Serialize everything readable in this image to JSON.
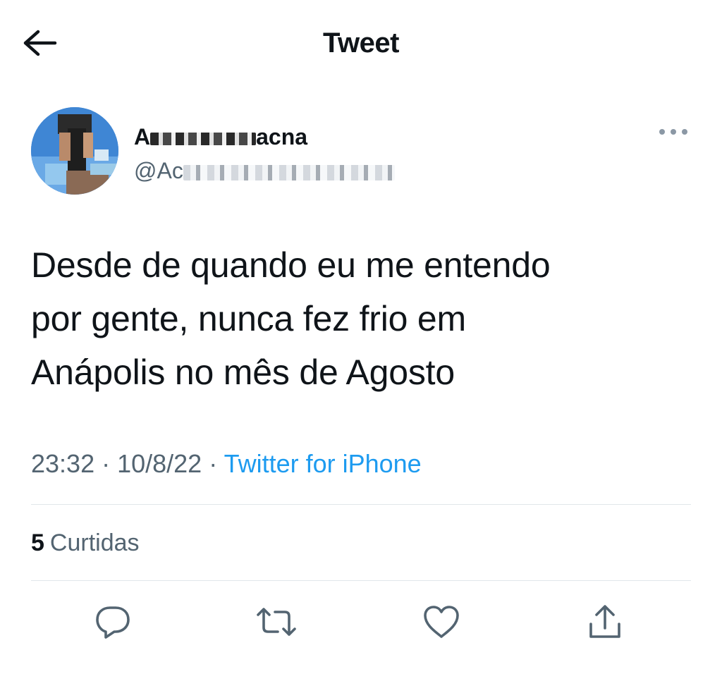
{
  "header": {
    "title": "Tweet",
    "back_icon": "arrow-left-icon"
  },
  "author": {
    "display_name_visible": "A",
    "display_name_tail": "acna",
    "handle_visible": "@Ac",
    "avatar": "user-avatar"
  },
  "tweet": {
    "lines": [
      "Desde de quando eu me entendo",
      "por gente, nunca fez frio em",
      "Anápolis no mês de Agosto"
    ],
    "time": "23:32",
    "date": "10/8/22",
    "separator": " · ",
    "source": "Twitter for iPhone"
  },
  "stats": {
    "likes_count": "5",
    "likes_label": "Curtidas"
  },
  "actions": {
    "reply_icon": "reply-icon",
    "retweet_icon": "retweet-icon",
    "like_icon": "heart-icon",
    "share_icon": "share-icon"
  },
  "colors": {
    "text_primary": "#0f1419",
    "text_secondary": "#536471",
    "accent": "#1d9bf0",
    "divider": "#e1e6ea"
  }
}
